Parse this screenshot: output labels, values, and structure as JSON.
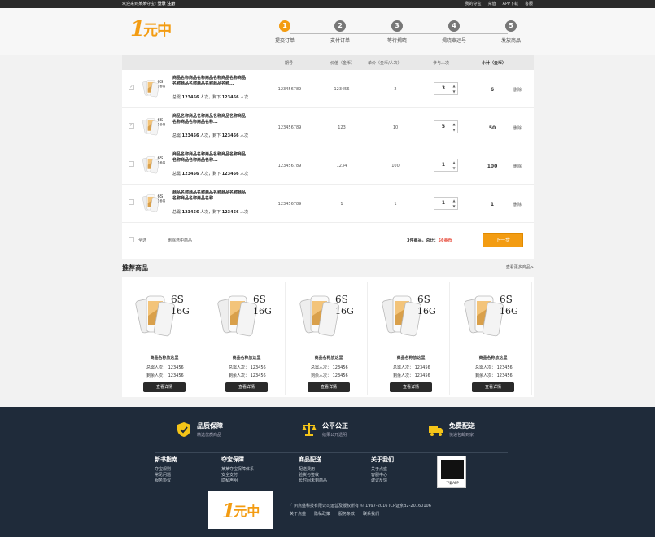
{
  "topbar": {
    "welcome": "欢迎来到某某夺宝!",
    "login": "登录",
    "register": "注册",
    "links": [
      "我的夺宝",
      "充值",
      "APP下载",
      "客服"
    ]
  },
  "logo": {
    "one": "1",
    "text": "元中"
  },
  "steps": [
    {
      "num": "1",
      "label": "提交订单",
      "active": true
    },
    {
      "num": "2",
      "label": "支付订单",
      "active": false
    },
    {
      "num": "3",
      "label": "等待揭晓",
      "active": false
    },
    {
      "num": "4",
      "label": "揭晓幸运号",
      "active": false
    },
    {
      "num": "5",
      "label": "发放商品",
      "active": false
    }
  ],
  "table": {
    "headers": {
      "issue": "期号",
      "value": "价值（金币）",
      "unit": "单价（金币/人次）",
      "join": "参与人次",
      "subtotal": "小计（金币）"
    },
    "rows": [
      {
        "checked": true,
        "title": "商品名称商品名称商品名称商品名称商品名称商品名称商品名称商品名称...",
        "total_label": "总需",
        "total": "123456",
        "unit_text": "人次，剩下",
        "remain": "123456",
        "unit2": "人次",
        "issue": "123456789",
        "value": "123456",
        "unit_price": "2",
        "qty": "3",
        "subtotal": "6",
        "del": "删除"
      },
      {
        "checked": true,
        "title": "商品名称商品名称商品名称商品名称商品名称商品名称商品名称...",
        "total_label": "总需",
        "total": "123456",
        "unit_text": "人次，剩下",
        "remain": "123456",
        "unit2": "人次",
        "issue": "123456789",
        "value": "123",
        "unit_price": "10",
        "qty": "5",
        "subtotal": "50",
        "del": "删除"
      },
      {
        "checked": false,
        "title": "商品名称商品名称商品名称商品名称商品名称商品名称商品名称...",
        "total_label": "总需",
        "total": "123456",
        "unit_text": "人次，剩下",
        "remain": "123456",
        "unit2": "人次",
        "issue": "123456789",
        "value": "1234",
        "unit_price": "100",
        "qty": "1",
        "subtotal": "100",
        "del": "删除"
      },
      {
        "checked": false,
        "title": "商品名称商品名称商品名称商品名称商品名称商品名称商品名称...",
        "total_label": "总需",
        "total": "123456",
        "unit_text": "人次，剩下",
        "remain": "123456",
        "unit2": "人次",
        "issue": "123456789",
        "value": "1",
        "unit_price": "1",
        "qty": "1",
        "subtotal": "1",
        "del": "删除"
      }
    ],
    "footer": {
      "select_all": "全选",
      "delete_selected": "删除选中商品",
      "summary_pre": "件商品，总计：",
      "count": "3",
      "total": "56金币",
      "next": "下一步"
    }
  },
  "recommend": {
    "title": "推荐商品",
    "more": "查看更多商品>",
    "items": [
      {
        "name": "商品名称放这里",
        "total_label": "总需人次：",
        "total": "123456",
        "remain_label": "剩余人次：",
        "remain": "123456",
        "btn": "查看详情"
      },
      {
        "name": "商品名称放这里",
        "total_label": "总需人次：",
        "total": "123456",
        "remain_label": "剩余人次：",
        "remain": "123456",
        "btn": "查看详情"
      },
      {
        "name": "商品名称放这里",
        "total_label": "总需人次：",
        "total": "123456",
        "remain_label": "剩余人次：",
        "remain": "123456",
        "btn": "查看详情"
      },
      {
        "name": "商品名称放这里",
        "total_label": "总需人次：",
        "total": "123456",
        "remain_label": "剩余人次：",
        "remain": "123456",
        "btn": "查看详情"
      },
      {
        "name": "商品名称放这里",
        "total_label": "总需人次：",
        "total": "123456",
        "remain_label": "剩余人次：",
        "remain": "123456",
        "btn": "查看详情"
      }
    ]
  },
  "phone": {
    "model": "6S",
    "size": "16G"
  },
  "footer": {
    "guarantees": [
      {
        "title": "品质保障",
        "sub": "精选优质商品",
        "icon": "shield-icon"
      },
      {
        "title": "公平公正",
        "sub": "结果公开透明",
        "icon": "scale-icon"
      },
      {
        "title": "免费配送",
        "sub": "快递包邮到家",
        "icon": "truck-icon"
      }
    ],
    "columns": [
      {
        "title": "新书指南",
        "items": [
          "夺宝规则",
          "常见问题",
          "服务协议"
        ]
      },
      {
        "title": "夺宝保障",
        "items": [
          "某某夺宝保障体系",
          "安全支付",
          "隐私声明"
        ]
      },
      {
        "title": "商品配送",
        "items": [
          "配送费用",
          "验货与签收",
          "长时间未到商品"
        ]
      },
      {
        "title": "关于我们",
        "items": [
          "关于点盛",
          "客服中心",
          "建议反馈"
        ]
      }
    ],
    "qr_caption": "下载APP",
    "copyright": "广州点盛科技有限公司运营及版权所有 © 1997-2016 ICP证京B2-20160106",
    "links": [
      "关于点盛",
      "隐私政策",
      "服务条款",
      "联系我们"
    ],
    "accent": "#f39c12"
  }
}
